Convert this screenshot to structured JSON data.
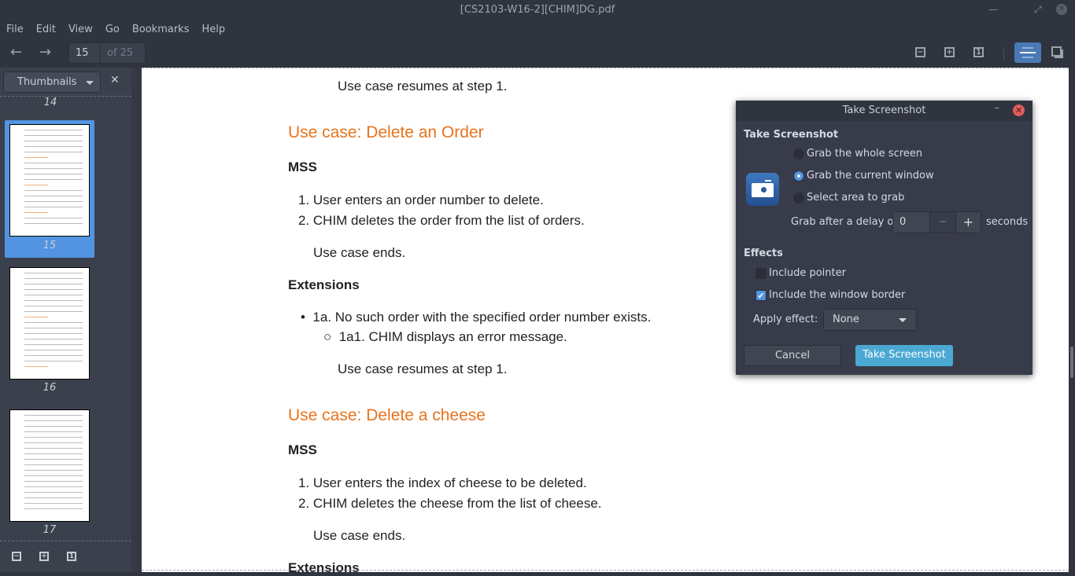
{
  "window": {
    "title": "[CS2103-W16-2][CHIM]DG.pdf"
  },
  "menu": [
    "File",
    "Edit",
    "View",
    "Go",
    "Bookmarks",
    "Help"
  ],
  "toolbar": {
    "page_current": "15",
    "page_total": "of 25"
  },
  "sidebar": {
    "mode": "Thumbnails",
    "pages": [
      "14",
      "15",
      "16",
      "17"
    ],
    "selected_page": "15"
  },
  "document": {
    "lines": [
      "Use case resumes at step 1.",
      "Use case: Delete an Order",
      "MSS",
      "1. User enters an order number to delete.",
      "2. CHIM deletes the order from the list of orders.",
      "Use case ends.",
      "Extensions",
      "1a. No such order with the specified order number exists.",
      "1a1. CHIM displays an error message.",
      "Use case resumes at step 1.",
      "Use case: Delete a cheese",
      "MSS",
      "1. User enters the index of cheese to be deleted.",
      "2. CHIM deletes the cheese from the list of cheese.",
      "Use case ends.",
      "Extensions"
    ]
  },
  "dialog": {
    "title": "Take Screenshot",
    "section_title": "Take Screenshot",
    "options": [
      "Grab the whole screen",
      "Grab the current window",
      "Select area to grab"
    ],
    "selected_option": "Grab the current window",
    "delay_label": "Grab after a delay of",
    "delay_value": "0",
    "delay_unit": "seconds",
    "effects_title": "Effects",
    "include_pointer": {
      "label": "Include pointer",
      "checked": false
    },
    "include_border": {
      "label": "Include the window border",
      "checked": true
    },
    "apply_effect_label": "Apply effect:",
    "apply_effect_value": "None",
    "cancel": "Cancel",
    "take": "Take Screenshot"
  },
  "colors": {
    "accent": "#5294e2",
    "heading": "#e8731c",
    "primary_button": "#4aa8d3"
  }
}
